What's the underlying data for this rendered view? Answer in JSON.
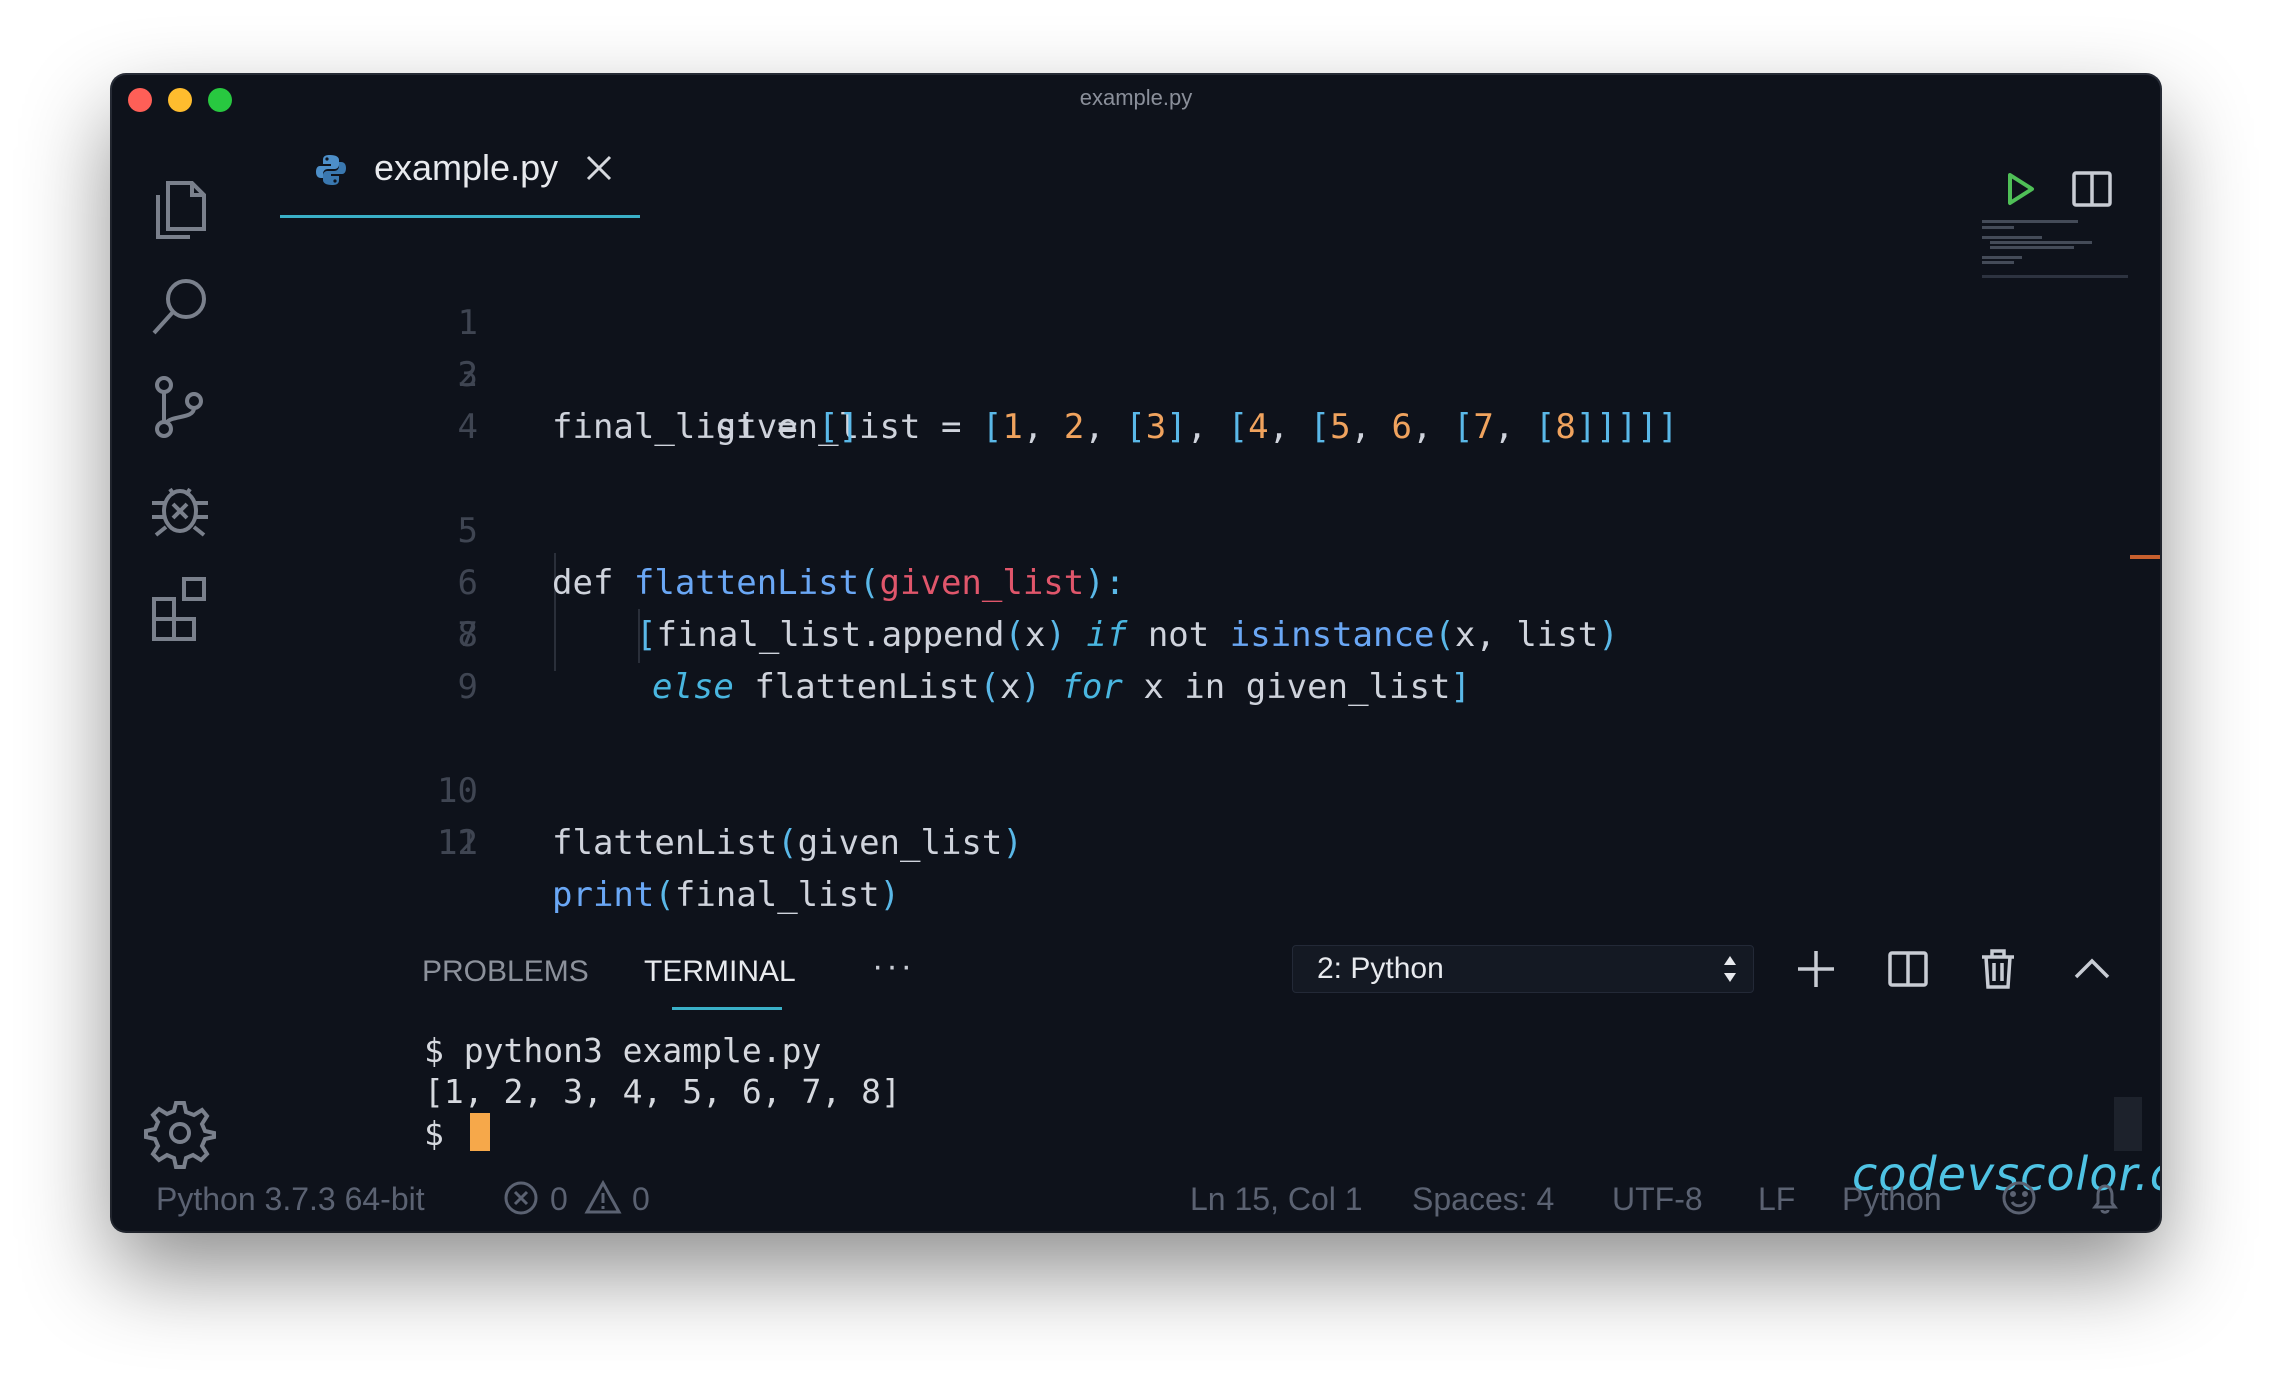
{
  "window": {
    "title": "example.py"
  },
  "colors": {
    "accent": "#3ab0c8",
    "background": "#0e121b",
    "cursor": "#f6a84a",
    "watermark": "#4fc3e4"
  },
  "activity_bar": {
    "icons": [
      "files-icon",
      "search-icon",
      "source-control-icon",
      "debug-icon",
      "extensions-icon",
      "gear-icon"
    ]
  },
  "tab": {
    "name": "example.py",
    "icon": "python-icon"
  },
  "editor_actions": [
    "run-icon",
    "split-editor-icon",
    "more-icon"
  ],
  "editor": {
    "line_numbers": [
      "1",
      "2",
      "3",
      "4",
      "5",
      "6",
      "7",
      "8",
      "9",
      "10",
      "11",
      "12"
    ],
    "lines": {
      "l1": [
        "given_list",
        " = ",
        "[",
        "1",
        ", ",
        "2",
        ", ",
        "[",
        "3",
        "]",
        ", ",
        "[",
        "4",
        ", ",
        "[",
        "5",
        ", ",
        "6",
        ", ",
        "[",
        "7",
        ", ",
        "[",
        "8",
        "]]]]]"
      ],
      "l2": [
        "final_list",
        " = ",
        "[]"
      ],
      "l5": [
        "def ",
        "flattenList",
        "(",
        "given_list",
        "):"
      ],
      "l6": [
        "[",
        "final_list.append",
        "(",
        "x",
        ")",
        " if ",
        "not ",
        "isinstance",
        "(",
        "x, list",
        ")"
      ],
      "l7": [
        "else",
        " flattenList",
        "(",
        "x",
        ")",
        " for",
        " x ",
        "in ",
        "given_list",
        "]"
      ],
      "l10": [
        "flattenList",
        "(",
        "given_list",
        ")"
      ],
      "l11": [
        "print",
        "(",
        "final_list",
        ")"
      ]
    }
  },
  "panel": {
    "tabs": {
      "problems": "PROBLEMS",
      "terminal": "TERMINAL"
    },
    "more": "···",
    "terminal_select": "2: Python",
    "buttons": [
      "add-icon",
      "split-terminal-icon",
      "trash-icon",
      "chevron-up-icon",
      "close-icon"
    ],
    "terminal_lines": [
      "$ python3 example.py",
      "[1, 2, 3, 4, 5, 6, 7, 8]",
      "$ "
    ]
  },
  "watermark": "codevscolor.com",
  "statusbar": {
    "interpreter": "Python 3.7.3 64-bit",
    "errors": "0",
    "warnings": "0",
    "position": "Ln 15, Col 1",
    "spaces": "Spaces: 4",
    "encoding": "UTF-8",
    "eol": "LF",
    "language": "Python"
  }
}
